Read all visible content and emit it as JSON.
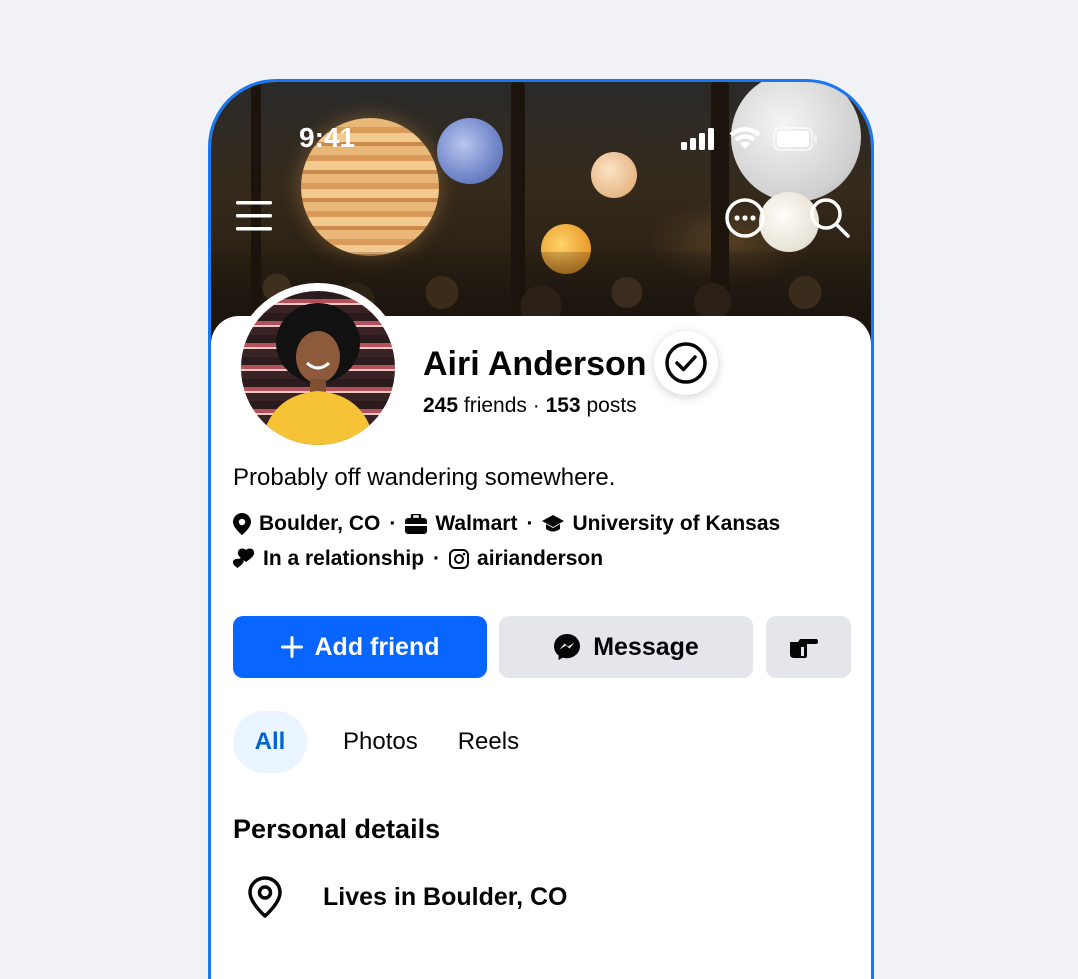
{
  "status_bar": {
    "time": "9:41"
  },
  "profile": {
    "name": "Airi Anderson",
    "friends_count": "245",
    "friends_label": " friends · ",
    "posts_count": "153",
    "posts_label": " posts",
    "bio": "Probably off wandering somewhere."
  },
  "info": {
    "location": "Boulder, CO",
    "work": "Walmart",
    "education": "University of Kansas",
    "relationship": "In a relationship",
    "instagram": "airianderson",
    "separator": "·"
  },
  "actions": {
    "add_friend": "Add friend",
    "message": "Message"
  },
  "tabs": [
    {
      "label": "All",
      "active": true
    },
    {
      "label": "Photos",
      "active": false
    },
    {
      "label": "Reels",
      "active": false
    }
  ],
  "personal_details": {
    "title": "Personal details",
    "lives_in": "Lives in Boulder, CO"
  },
  "colors": {
    "accent": "#0866FF",
    "frame": "#1877F2",
    "background": "#F0F2F5",
    "secondary_button": "#E4E6EB",
    "active_tab_bg": "#EBF5FF",
    "active_tab_text": "#0064D1"
  },
  "icons": {
    "menu": "hamburger-menu-icon",
    "more": "more-options-icon",
    "search": "search-icon",
    "verified": "verified-badge-icon",
    "location": "location-pin-icon",
    "work": "briefcase-icon",
    "education": "graduation-cap-icon",
    "relationship": "hearts-icon",
    "instagram": "instagram-icon",
    "add": "plus-icon",
    "messenger": "messenger-icon",
    "poke": "poke-hand-icon"
  }
}
